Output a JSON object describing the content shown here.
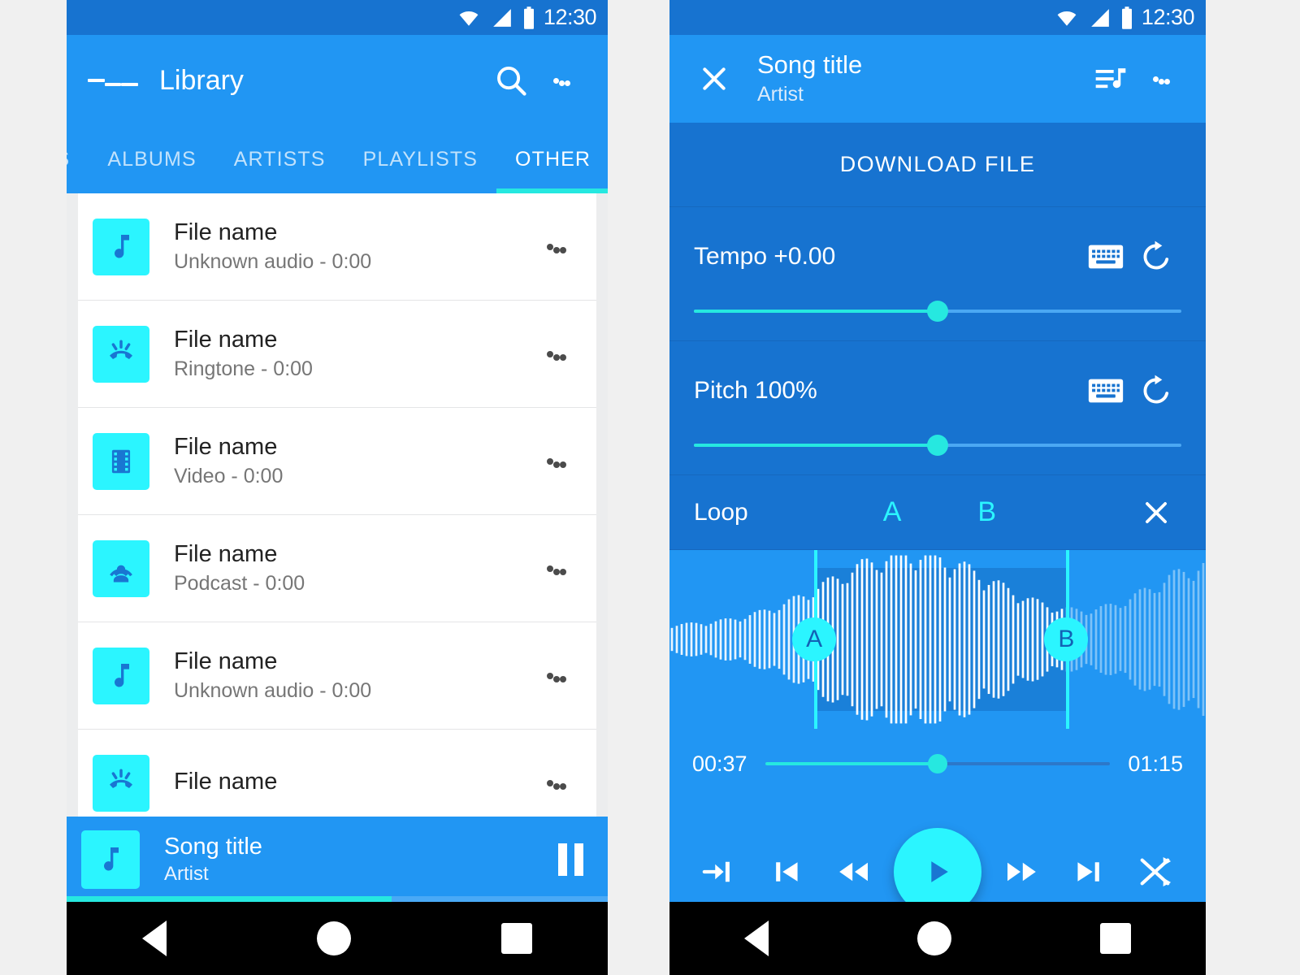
{
  "status_bar": {
    "time": "12:30",
    "icons": [
      "wifi-icon",
      "cell-signal-icon",
      "battery-icon"
    ]
  },
  "colors": {
    "primary": "#2196F3",
    "primary_dark": "#1773D0",
    "accent_cyan": "#2BF5FF",
    "accent_teal": "#26E8E0",
    "nav_bar": "#000000",
    "list_bg": "#ECEDEE",
    "row_bg": "#FFFFFF"
  },
  "left_screen": {
    "app_bar": {
      "menu_icon": "hamburger-menu-icon",
      "title": "Library",
      "search_icon": "search-icon",
      "overflow_icon": "overflow-menu-icon"
    },
    "tabs": [
      {
        "label": "GS",
        "active": false,
        "clipped": true
      },
      {
        "label": "ALBUMS",
        "active": false
      },
      {
        "label": "ARTISTS",
        "active": false
      },
      {
        "label": "PLAYLISTS",
        "active": false
      },
      {
        "label": "OTHER",
        "active": true
      }
    ],
    "list_items": [
      {
        "title": "File name",
        "subtitle": "Unknown audio - 0:00",
        "icon": "music-note-icon"
      },
      {
        "title": "File name",
        "subtitle": "Ringtone - 0:00",
        "icon": "ringtone-icon"
      },
      {
        "title": "File name",
        "subtitle": "Video - 0:00",
        "icon": "video-film-icon"
      },
      {
        "title": "File name",
        "subtitle": "Podcast - 0:00",
        "icon": "podcast-icon"
      },
      {
        "title": "File name",
        "subtitle": "Unknown audio - 0:00",
        "icon": "music-note-icon"
      },
      {
        "title": "File name",
        "subtitle": "",
        "icon": "ringtone-icon"
      }
    ],
    "mini_player": {
      "title": "Song title",
      "artist": "Artist",
      "thumb_icon": "music-note-icon",
      "action_icon": "pause-icon",
      "progress_percent": 60
    }
  },
  "right_screen": {
    "app_bar": {
      "close_icon": "close-icon",
      "title": "Song title",
      "artist": "Artist",
      "queue_icon": "queue-music-icon",
      "overflow_icon": "overflow-menu-icon"
    },
    "download_button": "DOWNLOAD FILE",
    "tempo": {
      "label": "Tempo +0.00",
      "keyboard_icon": "keyboard-icon",
      "reset_icon": "reset-refresh-icon",
      "slider_percent": 50
    },
    "pitch": {
      "label": "Pitch 100%",
      "keyboard_icon": "keyboard-icon",
      "reset_icon": "reset-refresh-icon",
      "slider_percent": 50
    },
    "loop": {
      "label": "Loop",
      "point_a": "A",
      "point_b": "B",
      "clear_icon": "close-icon",
      "marker_a_percent": 27,
      "marker_b_percent": 74
    },
    "waveform": {
      "selection_start_percent": 27,
      "selection_end_percent": 74
    },
    "seek": {
      "current_time": "00:37",
      "total_time": "01:15",
      "progress_percent": 50
    },
    "transport": [
      {
        "icon": "jump-to-icon",
        "name": "jump-to-button"
      },
      {
        "icon": "skip-previous-icon",
        "name": "skip-previous-button"
      },
      {
        "icon": "rewind-icon",
        "name": "rewind-button"
      },
      {
        "icon": "play-icon",
        "name": "play-button"
      },
      {
        "icon": "fast-forward-icon",
        "name": "fast-forward-button"
      },
      {
        "icon": "skip-next-icon",
        "name": "skip-next-button"
      },
      {
        "icon": "shuffle-icon",
        "name": "shuffle-button"
      }
    ]
  },
  "nav_bar": {
    "back": "back-icon",
    "home": "home-icon",
    "recents": "recents-icon"
  }
}
